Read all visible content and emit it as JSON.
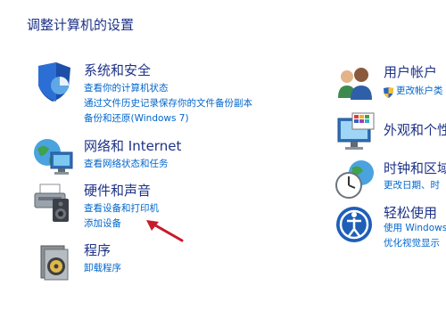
{
  "page": {
    "title": "调整计算机的设置"
  },
  "left_categories": [
    {
      "title": "系统和安全",
      "links": [
        "查看你的计算机状态",
        "通过文件历史记录保存你的文件备份副本",
        "备份和还原(Windows 7)"
      ],
      "icon": "shield-icon"
    },
    {
      "title": "网络和 Internet",
      "links": [
        "查看网络状态和任务"
      ],
      "icon": "network-globe-icon"
    },
    {
      "title": "硬件和声音",
      "links": [
        "查看设备和打印机",
        "添加设备"
      ],
      "icon": "printer-speaker-icon"
    },
    {
      "title": "程序",
      "links": [
        "卸载程序"
      ],
      "icon": "programs-icon"
    }
  ],
  "right_categories": [
    {
      "title": "用户帐户",
      "links": [
        "更改帐户类"
      ],
      "icon": "users-icon",
      "link_icon": "uac-shield-icon"
    },
    {
      "title": "外观和个性",
      "links": [],
      "icon": "appearance-icon"
    },
    {
      "title": "时钟和区域",
      "links": [
        "更改日期、时"
      ],
      "icon": "clock-globe-icon"
    },
    {
      "title": "轻松使用",
      "links": [
        "使用 Windows",
        "优化视觉显示"
      ],
      "icon": "ease-of-access-icon"
    }
  ],
  "annotation": {
    "icon": "red-arrow-icon",
    "color": "#c8192c"
  },
  "colors": {
    "title": "#1e3287",
    "link": "#0066cc"
  }
}
